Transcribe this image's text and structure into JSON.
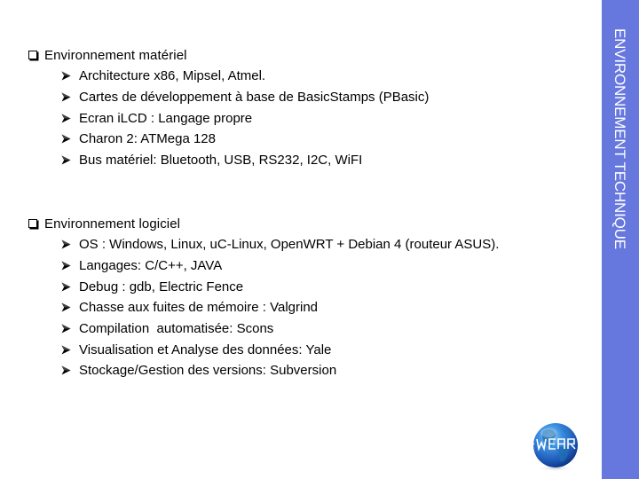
{
  "slide": {
    "side_title": "ENVIRONNEMENT TECHNIQUE",
    "colors": {
      "side_bar": "#6677dd",
      "side_text": "#ffffff",
      "text": "#000000"
    },
    "sections": [
      {
        "heading": "Environnement matériel",
        "bullet_icon": "square-bullet-icon",
        "items": [
          "Architecture x86, Mipsel, Atmel.",
          "Cartes de développement à base de BasicStamps (PBasic)",
          "Ecran iLCD : Langage propre",
          "Charon 2: ATMega 128",
          "Bus matériel: Bluetooth, USB, RS232, I2C, WiFI"
        ]
      },
      {
        "heading": "Environnement logiciel",
        "bullet_icon": "square-bullet-icon",
        "items": [
          "OS : Windows, Linux, uC-Linux, OpenWRT + Debian 4 (routeur ASUS).",
          "Langages: C/C++, JAVA",
          "Debug : gdb, Electric Fence",
          "Chasse aux fuites de mémoire : Valgrind",
          "Compilation  automatisée: Scons",
          "Visualisation et Analyse des données: Yale",
          "Stockage/Gestion des versions: Subversion"
        ]
      }
    ],
    "item_bullet_icon": "arrow-bullet-icon",
    "logo": {
      "text": "I-WEAR",
      "icon": "globe-logo-icon"
    }
  }
}
